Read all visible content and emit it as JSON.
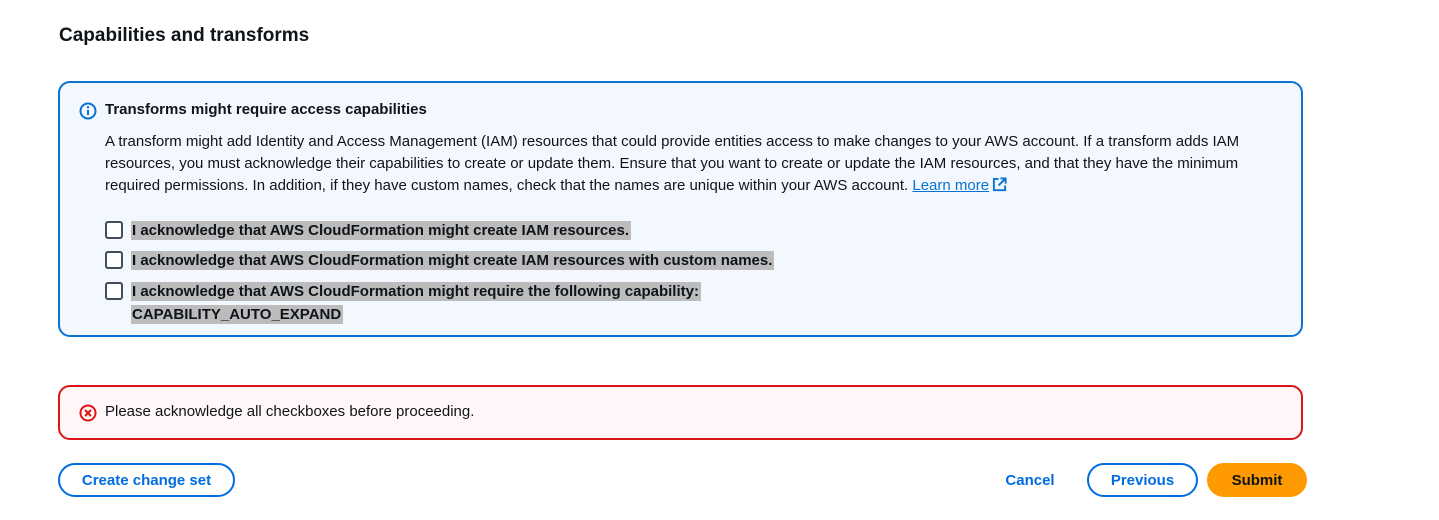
{
  "section": {
    "title": "Capabilities and transforms"
  },
  "info_alert": {
    "title": "Transforms might require access capabilities",
    "body": "A transform might add Identity and Access Management (IAM) resources that could provide entities access to make changes to your AWS account. If a transform adds IAM resources, you must acknowledge their capabilities to create or update them. Ensure that you want to create or update the IAM resources, and that they have the minimum required permissions. In addition, if they have custom names, check that the names are unique within your AWS account.",
    "learn_more_label": "Learn more",
    "icon": "info-circle-icon",
    "accent_color": "#0972d3"
  },
  "checkboxes": [
    {
      "label": "I acknowledge that AWS CloudFormation might create IAM resources.",
      "checked": false
    },
    {
      "label": "I acknowledge that AWS CloudFormation might create IAM resources with custom names.",
      "checked": false
    },
    {
      "label": "I acknowledge that AWS CloudFormation might require the following capability:",
      "label_line2": "CAPABILITY_AUTO_EXPAND",
      "checked": false
    }
  ],
  "error_alert": {
    "message": "Please acknowledge all checkboxes before proceeding.",
    "icon": "error-circle-icon",
    "accent_color": "#d91515"
  },
  "footer": {
    "create_change_set_label": "Create change set",
    "cancel_label": "Cancel",
    "previous_label": "Previous",
    "submit_label": "Submit",
    "primary_color": "#ff9900"
  }
}
